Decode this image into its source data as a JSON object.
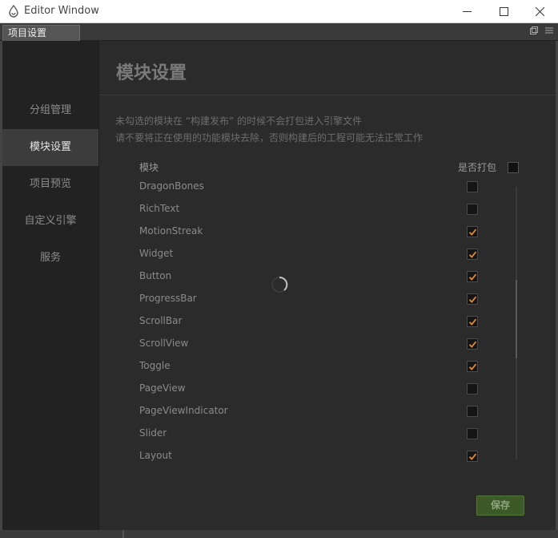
{
  "window": {
    "title": "Editor Window"
  },
  "tab": {
    "label": "项目设置"
  },
  "sidebar": {
    "items": [
      {
        "label": "分组管理",
        "active": false
      },
      {
        "label": "模块设置",
        "active": true
      },
      {
        "label": "项目预览",
        "active": false
      },
      {
        "label": "自定义引擎",
        "active": false
      },
      {
        "label": "服务",
        "active": false
      }
    ]
  },
  "main": {
    "title": "模块设置",
    "desc1": "未勾选的模块在 “构建发布” 的时候不会打包进入引擎文件",
    "desc2": "请不要将正在使用的功能模块去除，否则构建后的工程可能无法正常工作",
    "col_module": "模块",
    "col_pack": "是否打包",
    "rows": [
      {
        "name": "DragonBones",
        "checked": false
      },
      {
        "name": "RichText",
        "checked": false
      },
      {
        "name": "MotionStreak",
        "checked": true
      },
      {
        "name": "Widget",
        "checked": true
      },
      {
        "name": "Button",
        "checked": true
      },
      {
        "name": "ProgressBar",
        "checked": true
      },
      {
        "name": "ScrollBar",
        "checked": true
      },
      {
        "name": "ScrollView",
        "checked": true
      },
      {
        "name": "Toggle",
        "checked": true
      },
      {
        "name": "PageView",
        "checked": false
      },
      {
        "name": "PageViewIndicator",
        "checked": false
      },
      {
        "name": "Slider",
        "checked": false
      },
      {
        "name": "Layout",
        "checked": true
      }
    ],
    "save_label": "保存"
  },
  "colors": {
    "check": "#e0872f",
    "accent_green": "#3b5a27"
  }
}
